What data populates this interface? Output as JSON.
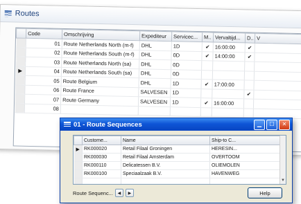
{
  "main": {
    "title": "Routes",
    "columns": [
      "Code",
      "Omschrijving",
      "Expediteur",
      "Servicec...",
      "M..",
      "Vervaltijd...",
      "D..",
      "V"
    ],
    "rows": [
      {
        "selected": false,
        "code": "01",
        "desc": "Route Netherlands North (m-f)",
        "exp": "DHL",
        "service": "1D",
        "m": "✔",
        "time": "16:00:00",
        "d": "✔"
      },
      {
        "selected": false,
        "code": "02",
        "desc": "Route Netherlands South (m-f)",
        "exp": "DHL",
        "service": "0D",
        "m": "✔",
        "time": "14:00:00",
        "d": "✔"
      },
      {
        "selected": false,
        "code": "03",
        "desc": "Route Netherlands North (sa)",
        "exp": "DHL",
        "service": "0D",
        "m": "",
        "time": "",
        "d": ""
      },
      {
        "selected": true,
        "code": "04",
        "desc": "Route Netherlands South (sa)",
        "exp": "DHL",
        "service": "0D",
        "m": "",
        "time": "",
        "d": ""
      },
      {
        "selected": false,
        "code": "05",
        "desc": "Route Belgium",
        "exp": "DHL",
        "service": "1D",
        "m": "✔",
        "time": "17:00:00",
        "d": ""
      },
      {
        "selected": false,
        "code": "06",
        "desc": "Route France",
        "exp": "SALVESEN",
        "service": "1D",
        "m": "",
        "time": "",
        "d": "✔"
      },
      {
        "selected": false,
        "code": "07",
        "desc": "Route Germany",
        "exp": "SALVESEN",
        "service": "1D",
        "m": "✔",
        "time": "16:00:00",
        "d": ""
      },
      {
        "selected": false,
        "code": "08",
        "desc": "",
        "exp": "",
        "service": "",
        "m": "",
        "time": "",
        "d": ""
      }
    ]
  },
  "dialog": {
    "title": "01 - Route Sequences",
    "columns": [
      "Custome...",
      "Name",
      "Ship-to C..."
    ],
    "rows": [
      {
        "selected": true,
        "customer": "RK000020",
        "name": "Retail Filaal Groningen",
        "shipto": "HERESIN..."
      },
      {
        "selected": false,
        "customer": "RK000030",
        "name": "Retail Filaal Amsterdam",
        "shipto": "OVERTOOM"
      },
      {
        "selected": false,
        "customer": "RK000110",
        "name": "Delicatessen B.V.",
        "shipto": "OLIEMOLEN"
      },
      {
        "selected": false,
        "customer": "RK000100",
        "name": "Speciaalzaak B.V.",
        "shipto": "HAVENWEG"
      }
    ],
    "footer_label": "Route Sequenc...",
    "help_label": "Help",
    "minimize_icon": "minimize-icon",
    "maximize_icon": "maximize-icon",
    "close_icon": "close-icon"
  },
  "colors": {
    "title_blue": "#0e55d6",
    "close_red": "#d23a12"
  }
}
